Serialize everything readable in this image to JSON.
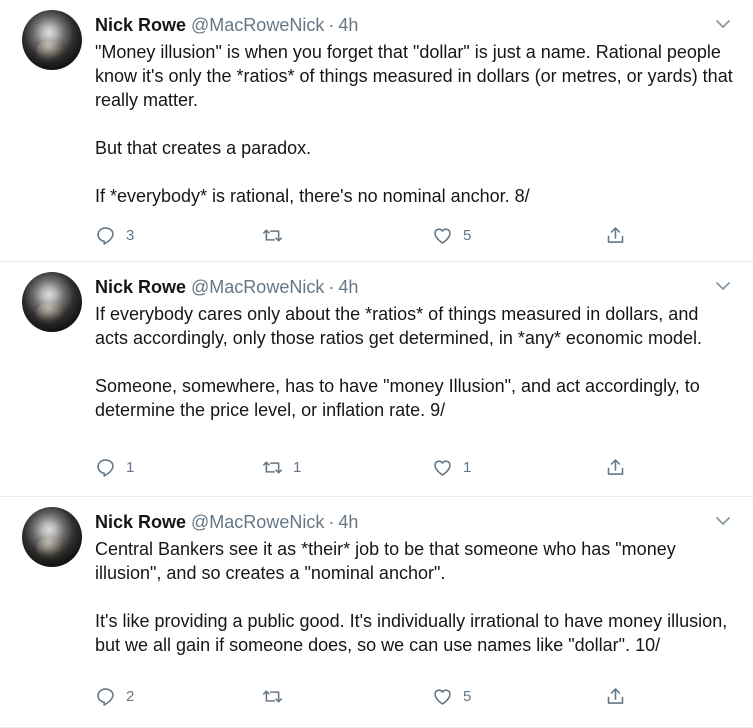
{
  "tweets": [
    {
      "name": "Nick Rowe",
      "handle": "@MacRoweNick",
      "separator": "·",
      "time": "4h",
      "paragraphs": [
        "\"Money illusion\" is when you forget that \"dollar\" is just a name. Rational people know it's only the *ratios* of things measured in dollars (or metres, or yards) that really matter.",
        "But that creates a paradox.",
        "If *everybody* is rational, there's no nominal anchor. 8/"
      ],
      "replies": "3",
      "retweets": "",
      "likes": "5"
    },
    {
      "name": "Nick Rowe",
      "handle": "@MacRoweNick",
      "separator": "·",
      "time": "4h",
      "paragraphs": [
        "If everybody cares only about the *ratios* of things measured in dollars, and acts accordingly, only those ratios get determined, in *any* economic model.",
        "Someone, somewhere, has to have \"money Illusion\", and act accordingly, to determine the price level, or inflation rate. 9/"
      ],
      "replies": "1",
      "retweets": "1",
      "likes": "1"
    },
    {
      "name": "Nick Rowe",
      "handle": "@MacRoweNick",
      "separator": "·",
      "time": "4h",
      "paragraphs": [
        "Central Bankers see it as *their* job to be that someone who has \"money illusion\", and so creates a \"nominal anchor\".",
        "It's like providing a public good. It's individually irrational to have money illusion, but we all gain if someone does, so we can use names like \"dollar\". 10/"
      ],
      "replies": "2",
      "retweets": "",
      "likes": "5"
    }
  ],
  "icons": {
    "reply": "reply-icon",
    "retweet": "retweet-icon",
    "like": "heart-icon",
    "share": "share-icon",
    "menu": "chevron-down-icon"
  },
  "colors": {
    "text": "#14171a",
    "muted": "#657786",
    "divider": "#e6ecf0"
  }
}
